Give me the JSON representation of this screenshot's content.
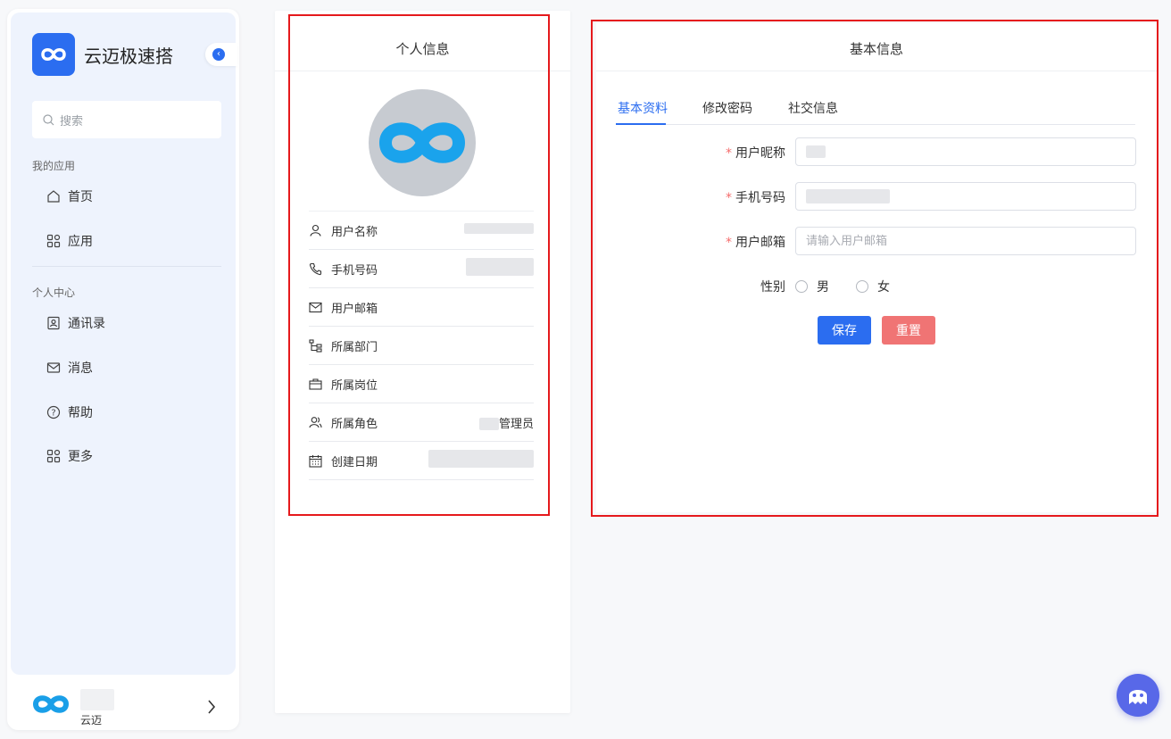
{
  "app": {
    "name": "云迈极速搭"
  },
  "sidebar": {
    "search_placeholder": "搜索",
    "section1": "我的应用",
    "section2": "个人中心",
    "items": [
      {
        "label": "首页",
        "icon": "home-icon"
      },
      {
        "label": "应用",
        "icon": "apps-grid-icon"
      },
      {
        "label": "通讯录",
        "icon": "contacts-icon"
      },
      {
        "label": "消息",
        "icon": "mail-icon"
      },
      {
        "label": "帮助",
        "icon": "help-icon"
      },
      {
        "label": "更多",
        "icon": "more-grid-icon"
      }
    ],
    "user": {
      "name": "云迈"
    }
  },
  "profile": {
    "title": "个人信息",
    "rows": [
      {
        "label": "用户名称",
        "icon": "user-icon",
        "value": ""
      },
      {
        "label": "手机号码",
        "icon": "phone-icon",
        "value": ""
      },
      {
        "label": "用户邮箱",
        "icon": "email-icon",
        "value": ""
      },
      {
        "label": "所属部门",
        "icon": "department-tree-icon",
        "value": ""
      },
      {
        "label": "所属岗位",
        "icon": "briefcase-icon",
        "value": ""
      },
      {
        "label": "所属角色",
        "icon": "role-users-icon",
        "value": "管理员"
      },
      {
        "label": "创建日期",
        "icon": "calendar-icon",
        "value": ""
      }
    ]
  },
  "basic": {
    "title": "基本信息",
    "tabs": [
      "基本资料",
      "修改密码",
      "社交信息"
    ],
    "fields": {
      "nickname_label": "用户昵称",
      "phone_label": "手机号码",
      "email_label": "用户邮箱",
      "email_placeholder": "请输入用户邮箱",
      "gender_label": "性别",
      "male": "男",
      "female": "女"
    },
    "save": "保存",
    "reset": "重置"
  },
  "colors": {
    "primary": "#2b6df0",
    "danger": "#f07474",
    "highlight": "#e5191c"
  }
}
